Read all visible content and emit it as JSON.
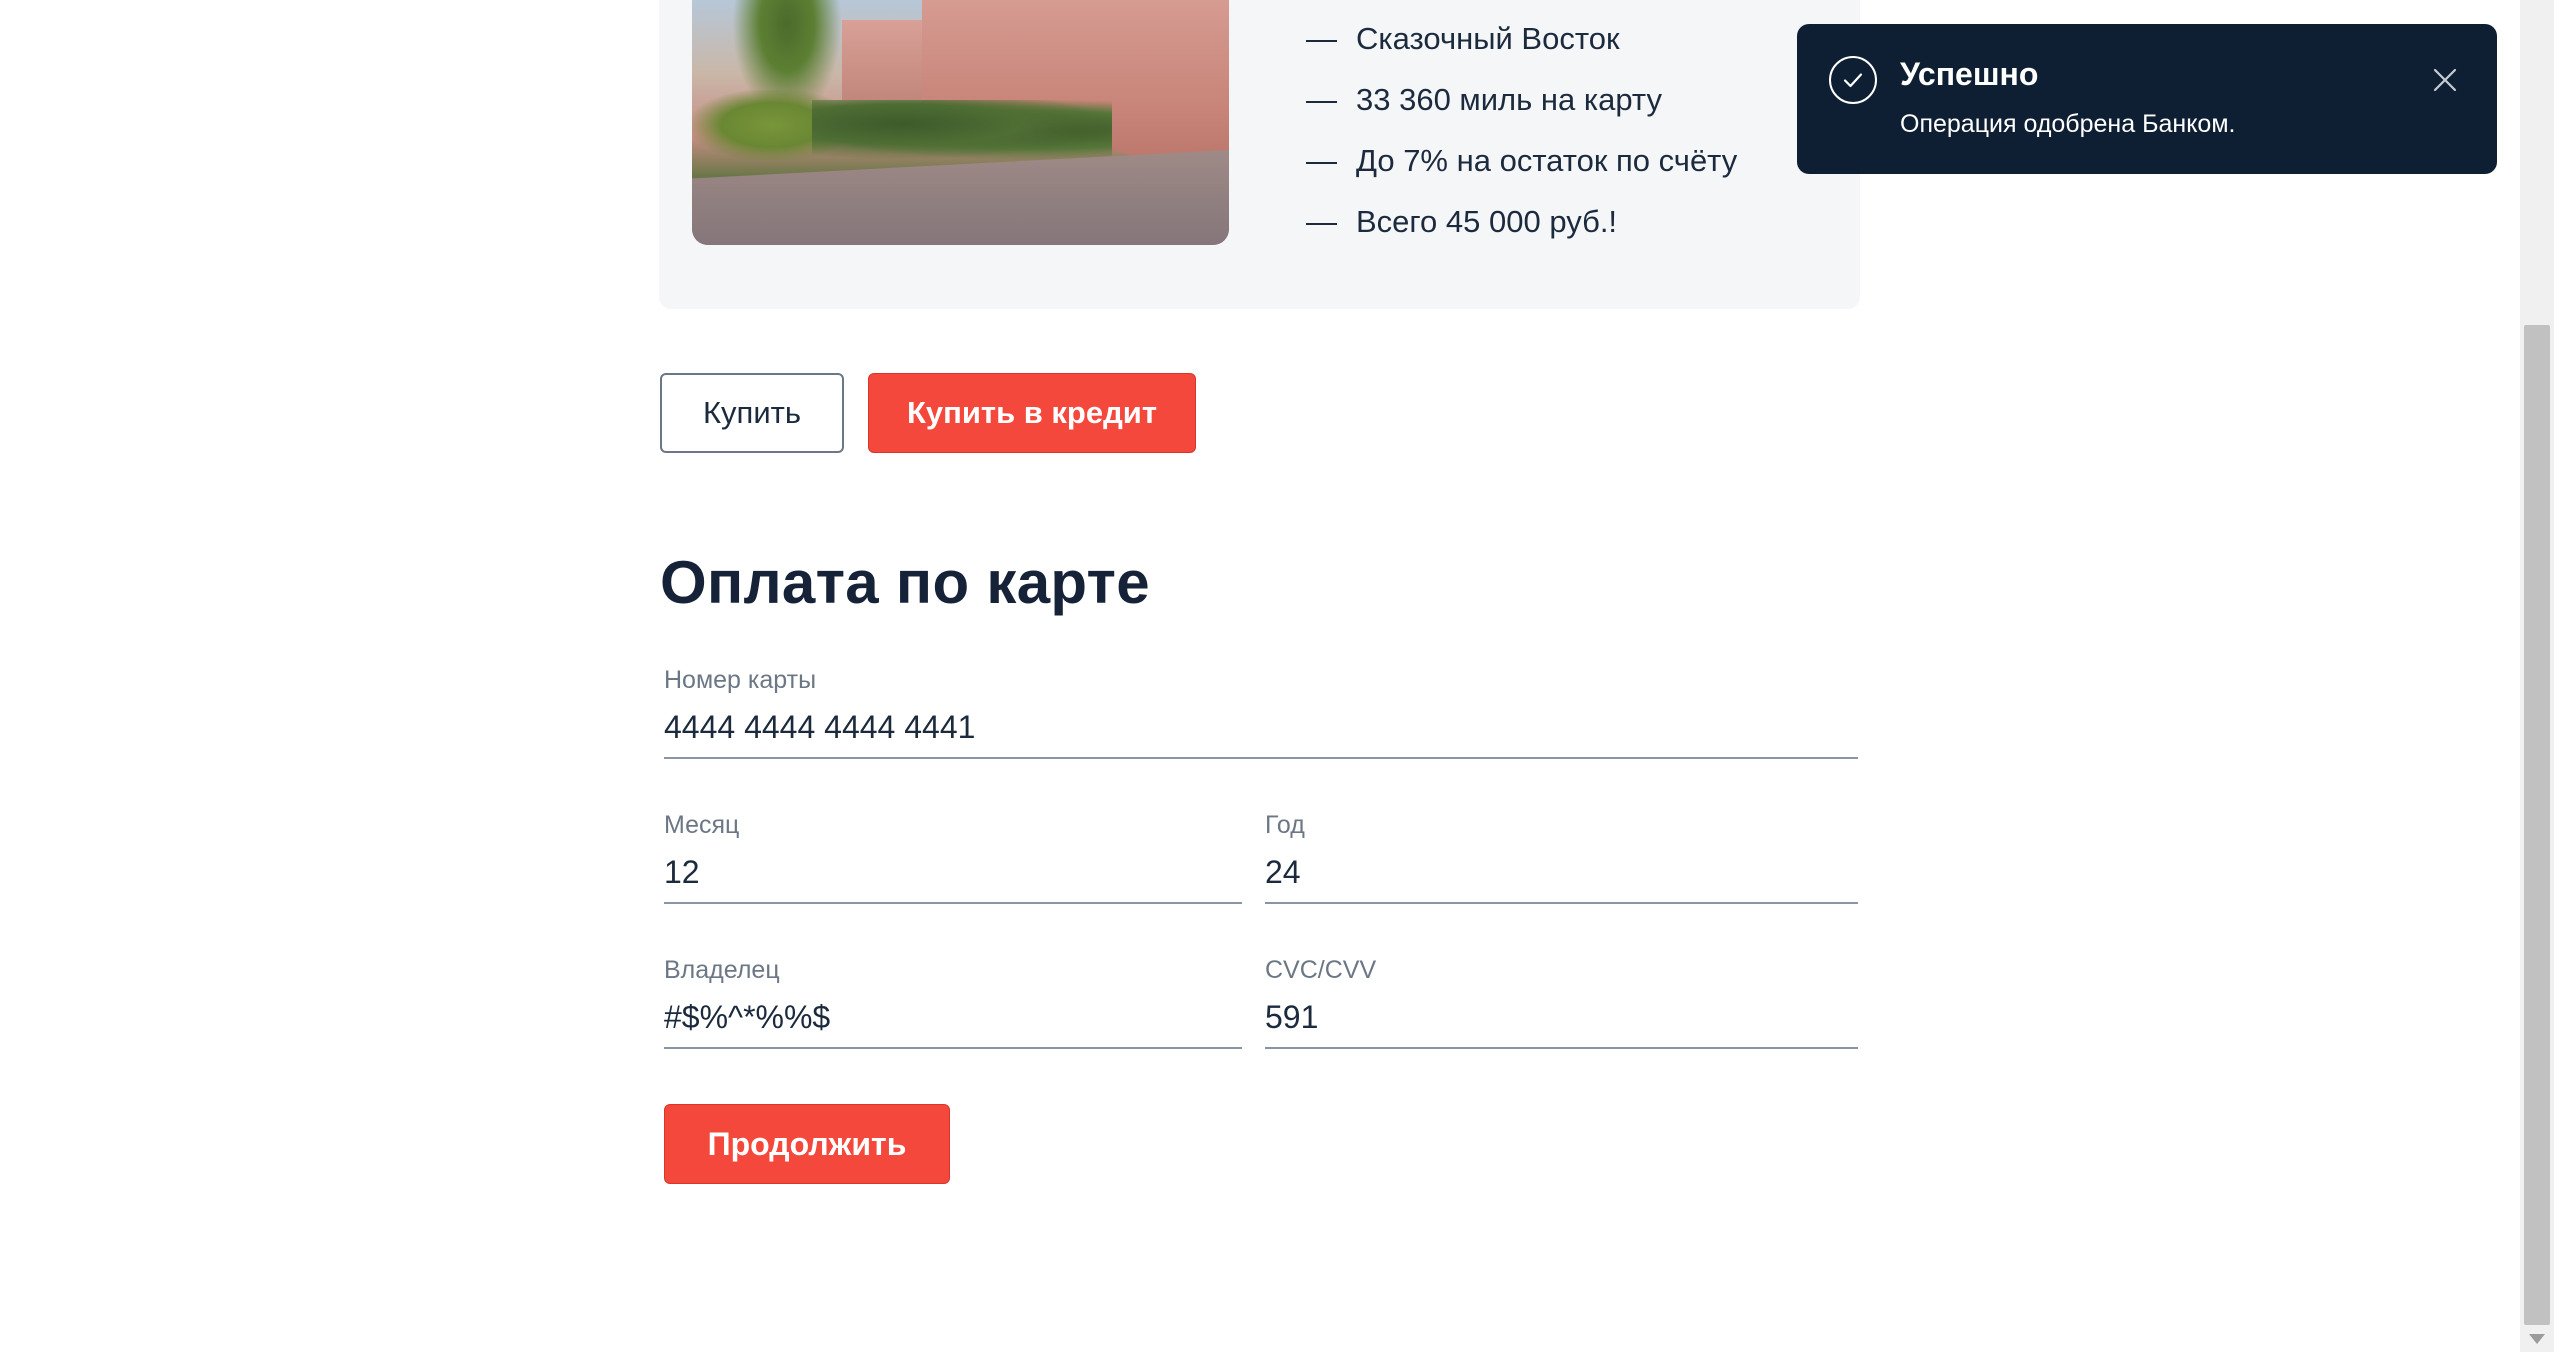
{
  "tour": {
    "features": [
      "Сказочный Восток",
      "33 360 миль на карту",
      "До 7% на остаток по счёту",
      "Всего 45 000 руб.!"
    ],
    "dash": "—"
  },
  "actions": {
    "buy_label": "Купить",
    "credit_label": "Купить в кредит"
  },
  "payment": {
    "title": "Оплата по карте",
    "card_number": {
      "label": "Номер карты",
      "value": "4444 4444 4444 4441"
    },
    "month": {
      "label": "Месяц",
      "value": "12"
    },
    "year": {
      "label": "Год",
      "value": "24"
    },
    "owner": {
      "label": "Владелец",
      "value": "#$%^*%%$"
    },
    "cvc": {
      "label": "CVC/CVV",
      "value": "591"
    },
    "continue_label": "Продолжить"
  },
  "toast": {
    "title": "Успешно",
    "message": "Операция одобрена Банком.",
    "icon": "check-circle-icon",
    "close_icon": "close-icon"
  },
  "colors": {
    "accent": "#f4483d",
    "toast_bg": "#0f1f33",
    "card_bg": "#f5f6f8",
    "text": "#1b2a3d"
  }
}
